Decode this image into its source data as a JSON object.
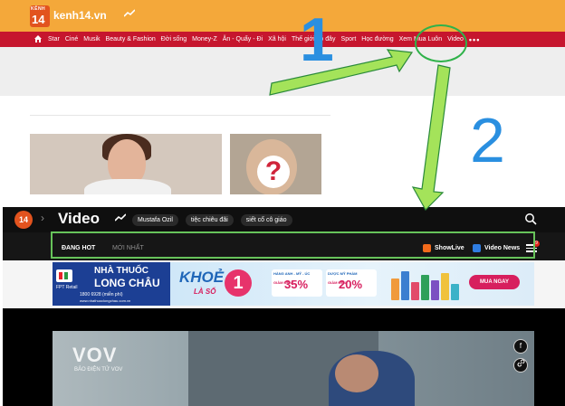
{
  "top_site": {
    "logo_small": "KÊNH",
    "logo_number": "14",
    "site_name": "kenh14.vn",
    "trending_icon": "trending-icon",
    "nav": {
      "home_icon": "home-icon",
      "items": [
        "Star",
        "Ciné",
        "Musik",
        "Beauty & Fashion",
        "Đời sống",
        "Money-Z",
        "Ăn - Quẩy - Đi",
        "Xã hội",
        "Thế giới đó đây",
        "Sport",
        "Học đường",
        "Xem Mua Luôn",
        "Video"
      ],
      "more_label": "•••"
    }
  },
  "annotations": {
    "step1": "1",
    "step2": "2"
  },
  "video_page": {
    "logo": "14",
    "chevron": "›",
    "title": "Video",
    "tags": [
      "Mustafa Ozil",
      "tiệc chiêu đãi",
      "siết cổ cô giáo"
    ],
    "tabs": {
      "active": "ĐANG HOT",
      "inactive": "MỚI NHẤT"
    },
    "showlive": "ShowLive",
    "video_news": "Video News",
    "menu_badge": "9"
  },
  "ads": {
    "long_chau": {
      "retail": "FPT Retail",
      "line1": "NHÀ THUỐC",
      "line2": "LONG CHÂU",
      "hotline": "1800 6928 (miễn phí)",
      "website": "www.nhathuoclongchau.com.vn"
    },
    "khoe": {
      "headline": "KHOẺ",
      "sub": "LÀ SỐ",
      "number": "1",
      "box1_title": "HÀNG ANH - MỸ - ÚC",
      "box1_prefix": "GIẢM ĐẾN",
      "box1_value": "35%",
      "box2_title": "DƯỢC MỸ PHẨM",
      "box2_prefix": "GIẢM ĐẾN",
      "box2_value": "20%",
      "cta": "MUA NGAY"
    }
  },
  "player": {
    "watermark": "VOV",
    "watermark_sub": "BẢO ĐIỆN TỬ VOV",
    "fb_icon": "f"
  },
  "colors": {
    "k14_orange": "#f4a83a",
    "k14_red": "#c6162e",
    "annotation_blue": "#2a8fe0",
    "annotation_green": "#67c35a"
  }
}
